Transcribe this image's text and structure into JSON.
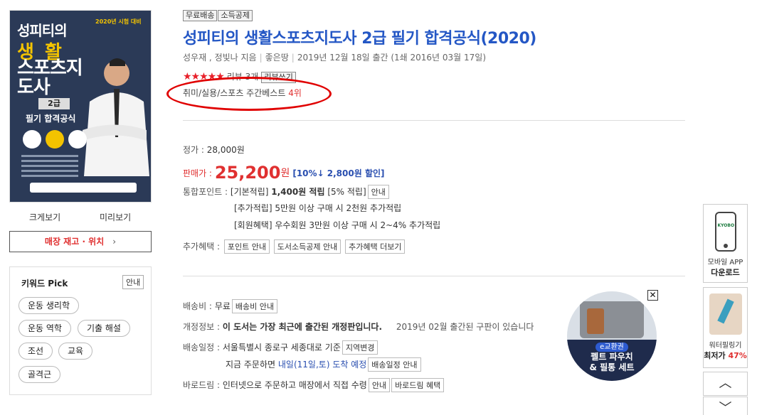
{
  "cover": {
    "title_line1": "성피티의",
    "title_line2": "생 활",
    "title_line3": "스포츠지도사",
    "level": "2급",
    "subtitle": "필기 합격공식",
    "year_note": "2020년 시험 대비"
  },
  "left": {
    "enlarge_label": "크게보기",
    "preview_label": "미리보기",
    "store_stock_label": "매장 재고 · 위치",
    "store_stock_chevron": "›"
  },
  "keyword": {
    "title": "키워드 Pick",
    "guide_label": "안내",
    "chips": [
      "운동 생리학",
      "운동 역학",
      "기출 해설",
      "조선",
      "교육",
      "골격근"
    ]
  },
  "product": {
    "tags": [
      "무료배송",
      "소득공제"
    ],
    "title": "성피티의 생활스포츠지도사 2급 필기 합격공식(2020)",
    "authors": "성우재 , 정빛나 지음",
    "publisher": "좋은땅",
    "pub_date": "2019년 12월 18일 출간 (1쇄 2016년 03월 17일)",
    "stars": "★★★★★",
    "review_text": "리뷰 3개",
    "review_write_label": "리뷰쓰기",
    "bestseller_prefix": "취미/실용/스포츠 주간베스트",
    "bestseller_rank": "4위"
  },
  "price": {
    "list_label": "정가 :",
    "list_price": "28,000원",
    "sale_label": "판매가 :",
    "sale_price": "25,200",
    "sale_unit": "원",
    "discount": "[10%↓ 2,800원 할인]",
    "points_label": "통합포인트 :",
    "points_basic": "[기본적립]",
    "points_basic_value": "1,400원 적립",
    "points_basic_rate": "[5% 적립]",
    "points_guide_label": "안내",
    "points_extra": "[추가적립] 5만원 이상 구매 시 2천원 추가적립",
    "points_member": "[회원혜택] 우수회원 3만원 이상 구매 시 2~4% 추가적립",
    "benefit_label": "추가혜택 :",
    "benefit_buttons": [
      "포인트 안내",
      "도서소득공제 안내",
      "추가혜택 더보기"
    ]
  },
  "shipping": {
    "fee_label": "배송비 :",
    "fee_value": "무료",
    "fee_guide_label": "배송비 안내",
    "revision_label": "개정정보 :",
    "revision_value": "이 도서는 가장 최근에 출간된 개정판입니다.",
    "revision_note": "2019년 02월 출간된 구판이 있습니다",
    "schedule_label": "배송일정 :",
    "schedule_value": "서울특별시 종로구 세종대로 기준",
    "region_change_label": "지역변경",
    "order_prefix": "지금 주문하면",
    "order_date": "내일(11일,토) 도착 예정",
    "schedule_guide_label": "배송일정 안내",
    "baro_label": "바로드림 :",
    "baro_value": "인터넷으로 주문하고 매장에서 직접 수령",
    "baro_guide_label": "안내",
    "baro_benefit_label": "바로드림 혜택"
  },
  "ad": {
    "pill": "e교환권",
    "line1": "펠트 파우치",
    "line2": "& 필통 세트",
    "close": "✕"
  },
  "sidebar": {
    "app_brand": "KYOBO",
    "app_label": "모바일 APP",
    "app_action": "다운로드",
    "promo_label": "워터필링기",
    "promo_price_prefix": "최저가",
    "promo_pct": "47%",
    "up_arrow": "︿",
    "down_arrow": "﹀"
  }
}
